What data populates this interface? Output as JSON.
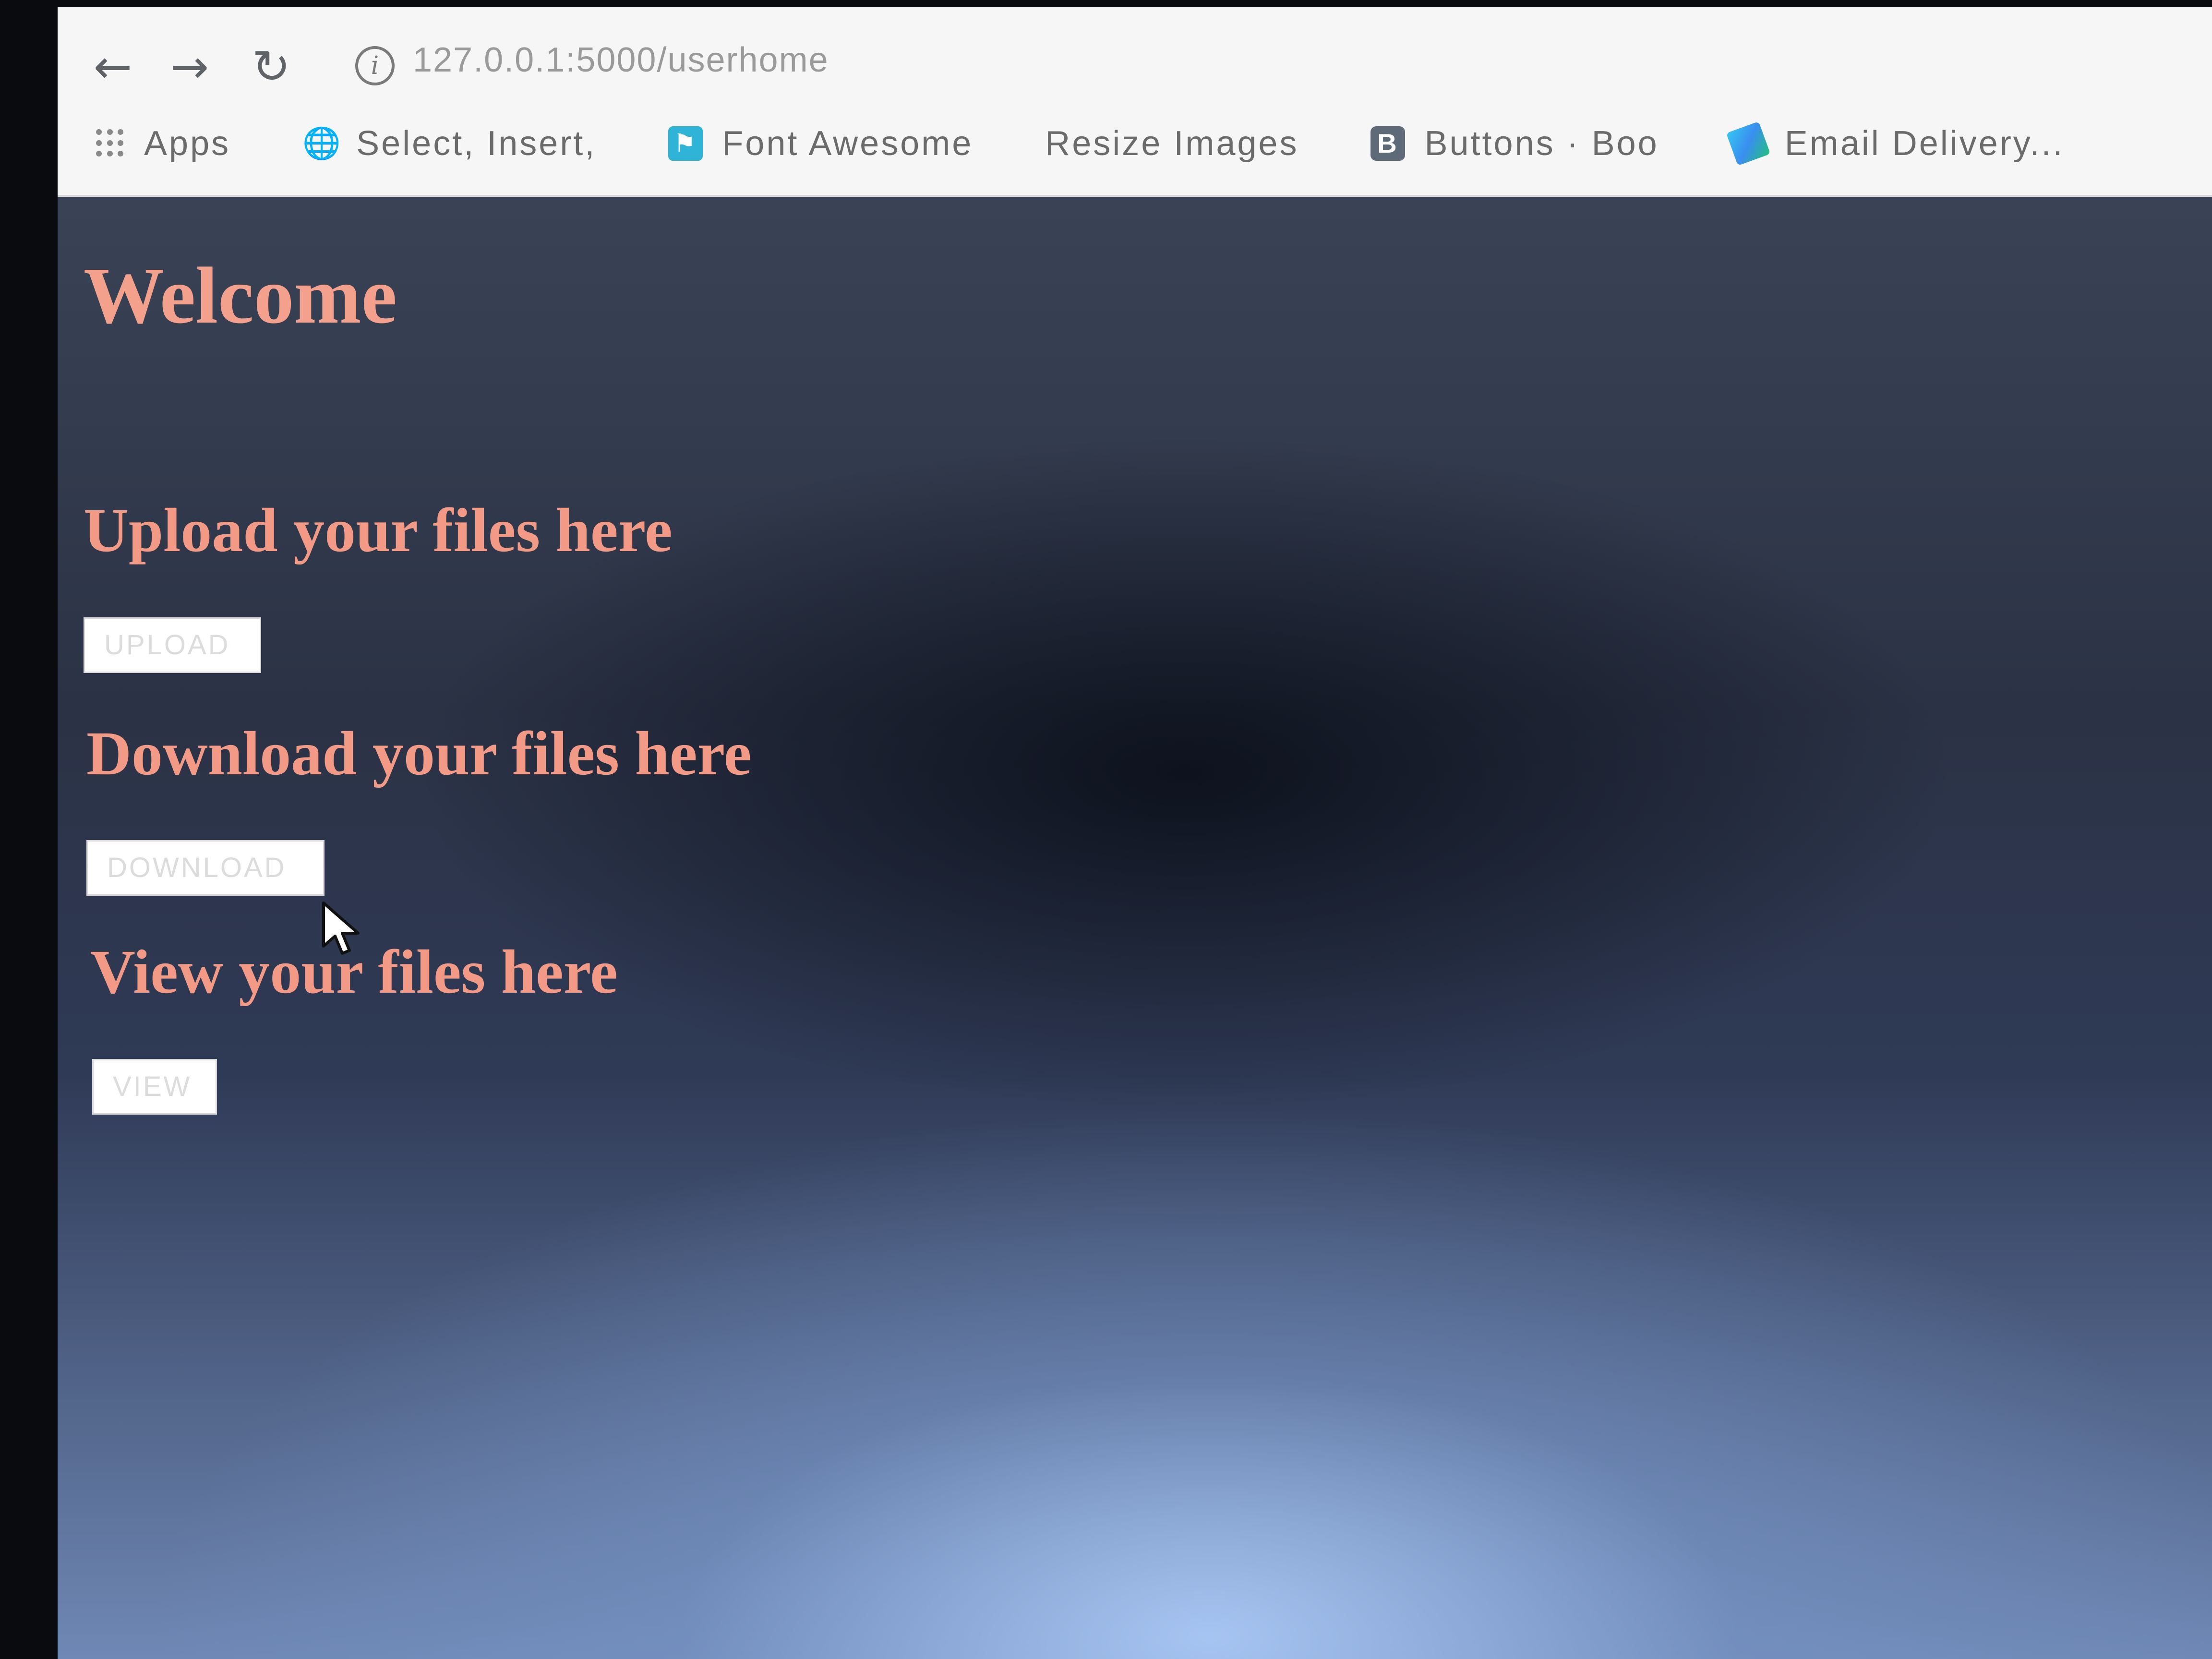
{
  "browser": {
    "url": "127.0.0.1:5000/userhome",
    "bookmarks": [
      {
        "label": "Apps",
        "icon": "apps-grid-icon"
      },
      {
        "label": "Select, Insert,",
        "icon": "globe-icon"
      },
      {
        "label": "Font Awesome",
        "icon": "font-awesome-icon"
      },
      {
        "label": "Resize Images",
        "icon": ""
      },
      {
        "label": "Buttons · Boo",
        "icon": "bootstrap-icon",
        "glyph": "B"
      },
      {
        "label": "Email Delivery...",
        "icon": "email-delivery-icon"
      }
    ]
  },
  "page": {
    "title": "Welcome",
    "upload": {
      "heading": "Upload your files here",
      "button": "UPLOAD"
    },
    "download": {
      "heading": "Download your files here",
      "button": "DOWNLOAD"
    },
    "view": {
      "heading": "View your files here",
      "button": "VIEW"
    }
  },
  "colors": {
    "heading": "#f39a86",
    "page_background": "#2b3245",
    "button_background": "#ffffff"
  }
}
